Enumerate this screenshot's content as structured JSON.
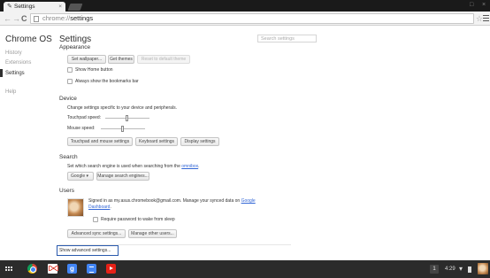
{
  "browser": {
    "tab_title": "Settings",
    "tab_close": "×",
    "window_controls": {
      "minimize": "□",
      "close": "×"
    },
    "nav": {
      "back": "←",
      "forward": "→",
      "reload": "C"
    },
    "url": {
      "scheme": "chrome://",
      "path": "settings"
    },
    "star": "☆"
  },
  "sidebar": {
    "title": "Chrome OS",
    "items": [
      "History",
      "Extensions",
      "Settings",
      "Help"
    ],
    "active": "Settings"
  },
  "settings": {
    "title": "Settings",
    "search_placeholder": "Search settings",
    "appearance": {
      "heading": "Appearance",
      "buttons": [
        "Set wallpaper...",
        "Get themes",
        "Reset to default theme"
      ],
      "checkboxes": [
        "Show Home button",
        "Always show the bookmarks bar"
      ]
    },
    "device": {
      "heading": "Device",
      "description": "Change settings specific to your device and peripherals.",
      "touchpad_label": "Touchpad speed:",
      "touchpad_level": 0.5,
      "mouse_label": "Mouse speed:",
      "mouse_level": 0.5,
      "buttons": [
        "Touchpad and mouse settings",
        "Keyboard settings",
        "Display settings"
      ]
    },
    "search": {
      "heading": "Search",
      "description_prefix": "Set which search engine is used when searching from the",
      "description_link": "omnibox",
      "engine": "Google",
      "manage_button": "Manage search engines..."
    },
    "users": {
      "heading": "Users",
      "signed_in_text": "Signed in as my.asus.chromebook@gmail.com. Manage your synced data on",
      "dashboard_link_1": "Google",
      "dashboard_link_2": "Dashboard",
      "dashboard_period": ".",
      "require_password": "Require password to wake from sleep",
      "buttons": [
        "Advanced sync settings...",
        "Manage other users..."
      ]
    },
    "show_advanced": "Show advanced settings..."
  },
  "shelf": {
    "apps": [
      "chrome",
      "gmail",
      "search",
      "docs",
      "youtube"
    ],
    "notification_count": "1",
    "time": "4:29",
    "status_icons": [
      "wifi-icon",
      "battery-icon"
    ]
  }
}
